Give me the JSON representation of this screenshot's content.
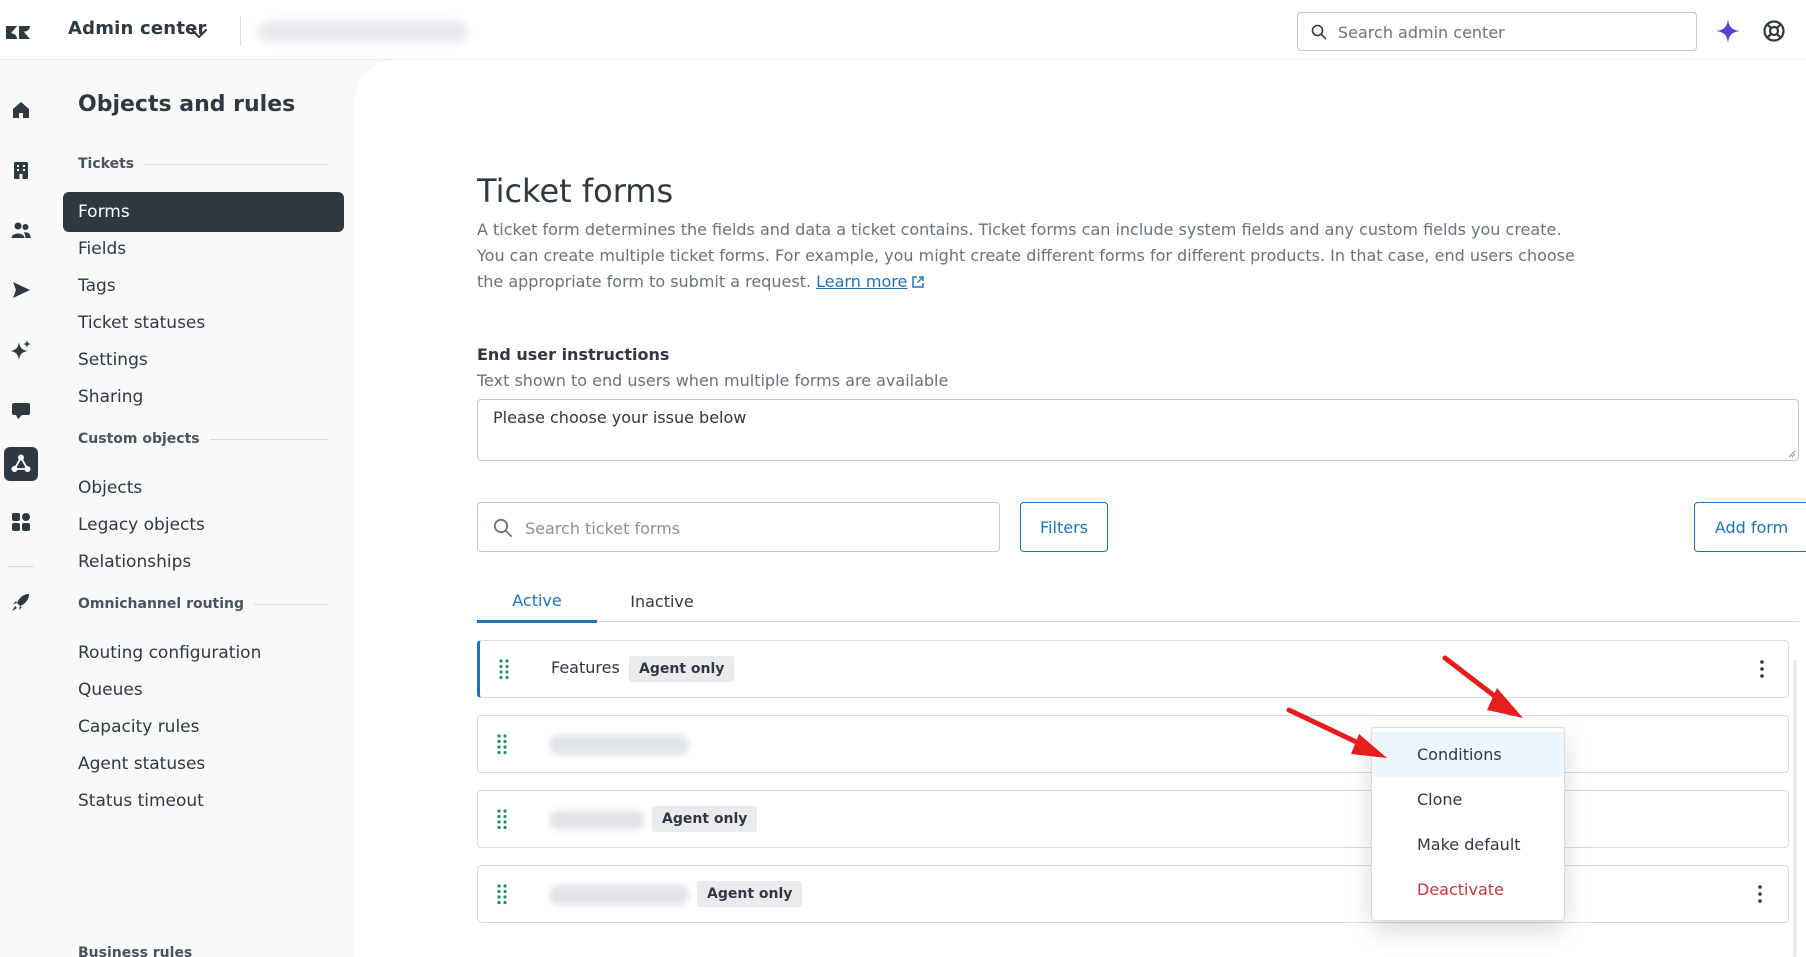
{
  "topbar": {
    "product": "Admin center",
    "search_placeholder": "Search admin center"
  },
  "subnav": {
    "title": "Objects and rules",
    "groups": [
      {
        "heading": "Tickets",
        "items": [
          "Forms",
          "Fields",
          "Tags",
          "Ticket statuses",
          "Settings",
          "Sharing"
        ]
      },
      {
        "heading": "Custom objects",
        "items": [
          "Objects",
          "Legacy objects",
          "Relationships"
        ]
      },
      {
        "heading": "Omnichannel routing",
        "items": [
          "Routing configuration",
          "Queues",
          "Capacity rules",
          "Agent statuses",
          "Status timeout"
        ]
      },
      {
        "heading": "Business rules",
        "items": []
      }
    ],
    "active_item": "Forms"
  },
  "rail": {
    "icons": [
      "home-icon",
      "building-icon",
      "people-icon",
      "send-icon",
      "sparkle-icon",
      "chat-icon",
      "objects-icon",
      "apps-icon",
      "rocket-icon",
      "sidebar-collapse-icon"
    ]
  },
  "main": {
    "title": "Ticket forms",
    "description": "A ticket form determines the fields and data a ticket contains. Ticket forms can include system fields and any custom fields you create. You can create multiple ticket forms. For example, you might create different forms for different products. In that case, end users choose the appropriate form to submit a request.",
    "learn_more": "Learn more",
    "end_user": {
      "label": "End user instructions",
      "hint": "Text shown to end users when multiple forms are available",
      "value": "Please choose your issue below"
    },
    "search_placeholder": "Search ticket forms",
    "filters_label": "Filters",
    "add_form_label": "Add form",
    "tabs": [
      {
        "label": "Active",
        "active": true
      },
      {
        "label": "Inactive",
        "active": false
      }
    ],
    "rows": [
      {
        "name": "Features",
        "badge": "Agent only",
        "blurred": false
      },
      {
        "name": "",
        "badge": "",
        "blurred": true
      },
      {
        "name": "",
        "badge": "Agent only",
        "blurred": true
      },
      {
        "name": "",
        "badge": "Agent only",
        "blurred": true
      }
    ],
    "menu": {
      "items": [
        {
          "label": "Conditions",
          "hover": true
        },
        {
          "label": "Clone"
        },
        {
          "label": "Make default"
        },
        {
          "label": "Deactivate",
          "danger": true
        }
      ]
    }
  },
  "colors": {
    "accent": "#1f73b7",
    "danger": "#cc3340",
    "annotation_arrow": "#e81e1e",
    "nav_active": "#2f3941",
    "ai_sparkle": "#5d3fd3"
  }
}
